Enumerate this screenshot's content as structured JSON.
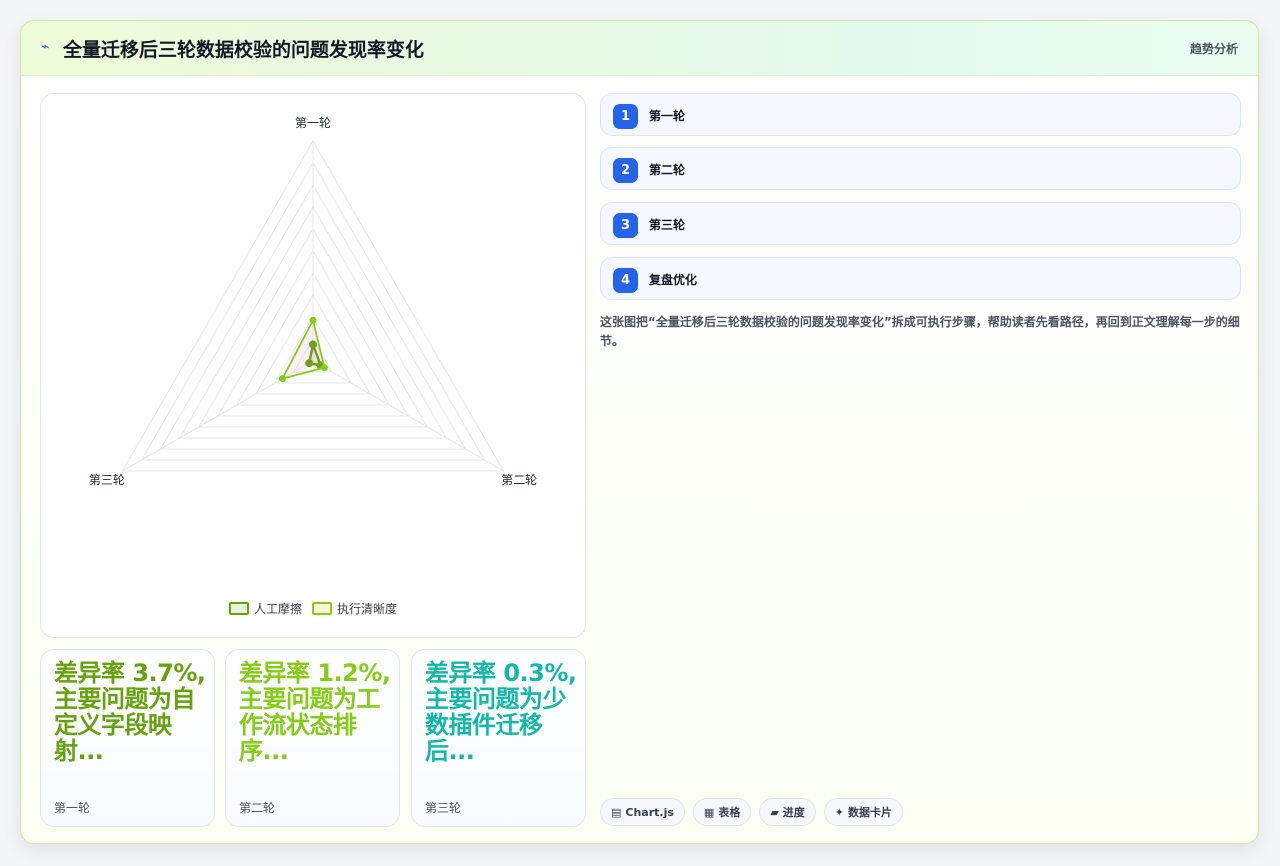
{
  "header": {
    "icon": "trend-line-icon",
    "title": "全量迁移后三轮数据校验的问题发现率变化",
    "badge": "趋势分析"
  },
  "chart_data": {
    "type": "radar",
    "axes": [
      "第一轮",
      "第二轮",
      "第三轮"
    ],
    "series": [
      {
        "name": "人工摩擦",
        "values": [
          1.5,
          0.8,
          0.4
        ],
        "color": "#65a30d"
      },
      {
        "name": "执行清晰度",
        "values": [
          3.7,
          1.2,
          3.2
        ],
        "color": "#84cc16"
      }
    ],
    "rmax": 20,
    "grid_levels": 10
  },
  "stats": [
    {
      "value": "差异率 3.7%, 主要问题为自定义字段映射...",
      "label": "第一轮",
      "color": "#65a30d"
    },
    {
      "value": "差异率 1.2%, 主要问题为工作流状态排序...",
      "label": "第二轮",
      "color": "#84cc16"
    },
    {
      "value": "差异率 0.3%, 主要问题为少数插件迁移后...",
      "label": "第三轮",
      "color": "#14b8a6"
    }
  ],
  "steps": [
    {
      "num": "1",
      "label": "第一轮"
    },
    {
      "num": "2",
      "label": "第二轮"
    },
    {
      "num": "3",
      "label": "第三轮"
    },
    {
      "num": "4",
      "label": "复盘优化"
    }
  ],
  "description": "这张图把“全量迁移后三轮数据校验的问题发现率变化”拆成可执行步骤，帮助读者先看路径，再回到正文理解每一步的细节。",
  "tags": [
    {
      "icon": "chart-icon",
      "glyph": "▤",
      "label": "Chart.js"
    },
    {
      "icon": "table-icon",
      "glyph": "▦",
      "label": "表格"
    },
    {
      "icon": "progress-icon",
      "glyph": "▰",
      "label": "进度"
    },
    {
      "icon": "sparkle-icon",
      "glyph": "✦",
      "label": "数据卡片"
    }
  ]
}
